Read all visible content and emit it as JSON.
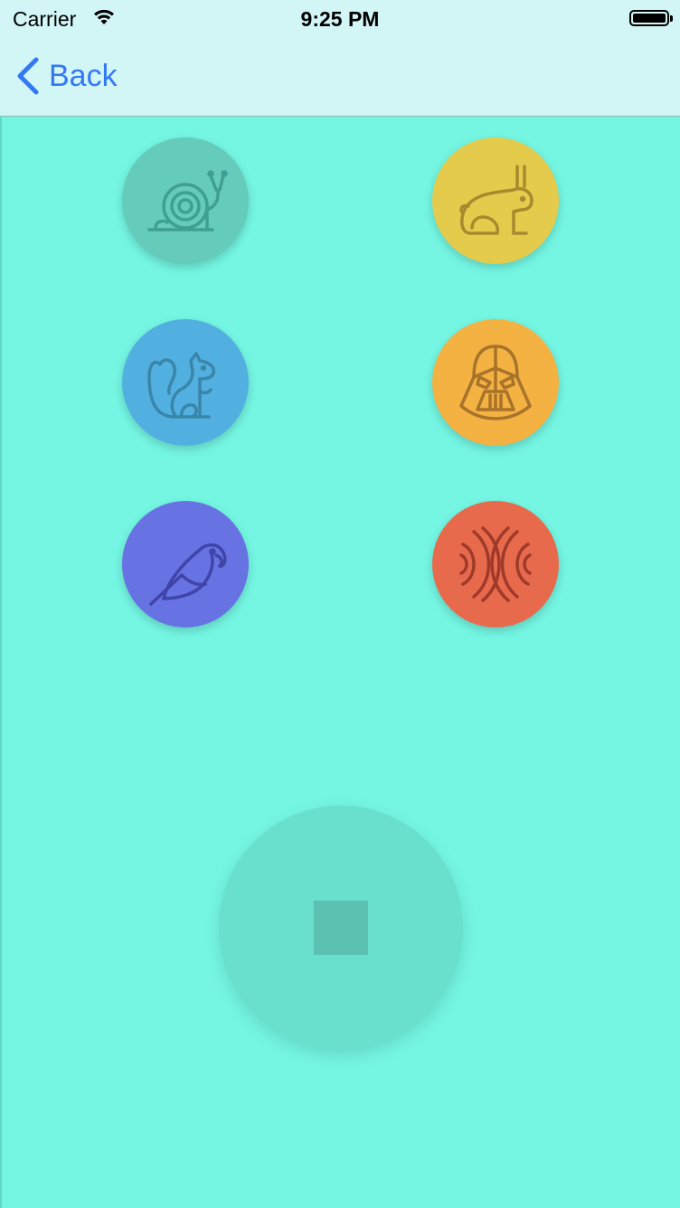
{
  "status_bar": {
    "carrier": "Carrier",
    "time": "9:25 PM",
    "battery_level": 1.0
  },
  "nav": {
    "back_label": "Back"
  },
  "colors": {
    "background": "#74f6e3",
    "nav_bar": "#d2f6f5",
    "accent": "#3478f6",
    "snail": "#65cbbb",
    "rabbit": "#e5cb4c",
    "squirrel": "#52b0e0",
    "vader": "#f4b243",
    "parrot": "#6772e3",
    "wave": "#e86a4c",
    "stop_button": "#68e0cd",
    "stop_square": "#5bc1b1"
  },
  "effect_buttons": [
    {
      "id": "snail",
      "icon": "snail-icon"
    },
    {
      "id": "rabbit",
      "icon": "rabbit-icon"
    },
    {
      "id": "squirrel",
      "icon": "squirrel-icon"
    },
    {
      "id": "vader",
      "icon": "darth-vader-icon"
    },
    {
      "id": "parrot",
      "icon": "parrot-icon"
    },
    {
      "id": "wave",
      "icon": "echo-wave-icon"
    }
  ],
  "stop": {
    "icon": "stop-icon"
  }
}
